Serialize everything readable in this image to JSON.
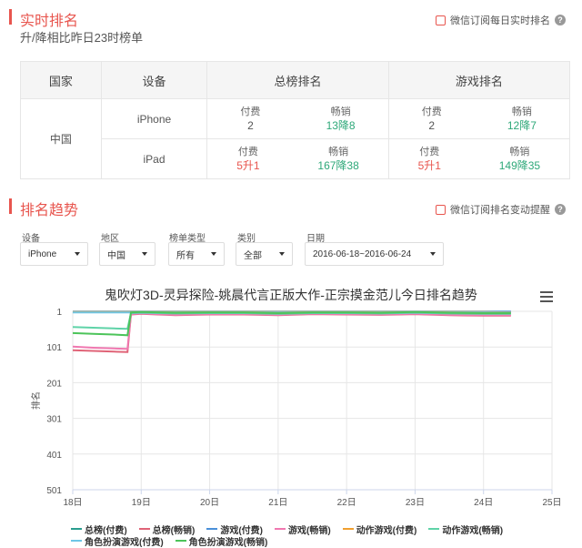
{
  "realtime": {
    "title": "实时排名",
    "subtitle": "升/降相比昨日23时榜单",
    "subscribe": "微信订阅每日实时排名",
    "help": "?"
  },
  "table": {
    "headers": [
      "国家",
      "设备",
      "总榜排名",
      "游戏排名"
    ],
    "country": "中国",
    "rows": [
      {
        "device": "iPhone",
        "total": {
          "paid_label": "付费",
          "paid_value": "2",
          "sales_label": "畅销",
          "sales_value": "13降8"
        },
        "game": {
          "paid_label": "付费",
          "paid_value": "2",
          "sales_label": "畅销",
          "sales_value": "12降7"
        }
      },
      {
        "device": "iPad",
        "total": {
          "paid_label": "付费",
          "paid_value": "5升1",
          "sales_label": "畅销",
          "sales_value": "167降38"
        },
        "game": {
          "paid_label": "付费",
          "paid_value": "5升1",
          "sales_label": "畅销",
          "sales_value": "149降35"
        }
      }
    ]
  },
  "trend": {
    "title": "排名趋势",
    "subscribe": "微信订阅排名变动提醒",
    "help": "?",
    "filters": [
      {
        "label": "设备",
        "value": "iPhone"
      },
      {
        "label": "地区",
        "value": "中国"
      },
      {
        "label": "榜单类型",
        "value": "所有"
      },
      {
        "label": "类别",
        "value": "全部"
      },
      {
        "label": "日期",
        "value": "2016-06-18~2016-06-24"
      }
    ]
  },
  "chart_data": {
    "type": "line",
    "title": "鬼吹灯3D-灵异探险-姚晨代言正版大作-正宗摸金范儿今日排名趋势",
    "ylabel": "排名",
    "y_reversed": true,
    "ylim": [
      1,
      501
    ],
    "yticks": [
      "1",
      "101",
      "201",
      "301",
      "401",
      "501"
    ],
    "x_ticks": [
      "18日",
      "19日",
      "20日",
      "21日",
      "22日",
      "23日",
      "24日",
      "25日"
    ],
    "xlim": [
      18,
      25
    ],
    "grid": true,
    "legend_position": "bottom",
    "series": [
      {
        "name": "总榜(付费)",
        "color": "#2a9d8f",
        "points": [
          [
            18,
            2
          ],
          [
            18.8,
            2
          ],
          [
            19,
            2
          ],
          [
            20,
            2
          ],
          [
            21,
            2
          ],
          [
            22,
            2
          ],
          [
            23,
            2
          ],
          [
            24,
            2
          ],
          [
            24.4,
            2
          ]
        ]
      },
      {
        "name": "总榜(畅销)",
        "color": "#e06377",
        "points": [
          [
            18,
            110
          ],
          [
            18.3,
            112
          ],
          [
            18.6,
            114
          ],
          [
            18.8,
            115
          ],
          [
            18.85,
            10
          ],
          [
            19,
            8
          ],
          [
            19.5,
            12
          ],
          [
            20,
            10
          ],
          [
            20.5,
            10
          ],
          [
            21,
            12
          ],
          [
            21.5,
            9
          ],
          [
            22,
            10
          ],
          [
            22.5,
            11
          ],
          [
            23,
            9
          ],
          [
            23.5,
            12
          ],
          [
            24,
            13
          ],
          [
            24.4,
            13
          ]
        ]
      },
      {
        "name": "游戏(付费)",
        "color": "#4a90d9",
        "points": [
          [
            18,
            2
          ],
          [
            18.8,
            2
          ],
          [
            19,
            2
          ],
          [
            20,
            2
          ],
          [
            21,
            2
          ],
          [
            22,
            2
          ],
          [
            23,
            2
          ],
          [
            24,
            2
          ],
          [
            24.4,
            2
          ]
        ]
      },
      {
        "name": "游戏(畅销)",
        "color": "#f078b0",
        "points": [
          [
            18,
            100
          ],
          [
            18.3,
            103
          ],
          [
            18.6,
            105
          ],
          [
            18.8,
            106
          ],
          [
            18.85,
            9
          ],
          [
            19,
            7
          ],
          [
            19.5,
            11
          ],
          [
            20,
            9
          ],
          [
            20.5,
            9
          ],
          [
            21,
            11
          ],
          [
            21.5,
            8
          ],
          [
            22,
            9
          ],
          [
            22.5,
            10
          ],
          [
            23,
            8
          ],
          [
            23.5,
            11
          ],
          [
            24,
            12
          ],
          [
            24.4,
            12
          ]
        ]
      },
      {
        "name": "动作游戏(付费)",
        "color": "#f0a030",
        "points": [
          [
            18,
            3
          ],
          [
            18.8,
            3
          ],
          [
            19,
            3
          ],
          [
            20,
            3
          ],
          [
            21,
            3
          ],
          [
            22,
            3
          ],
          [
            23,
            3
          ],
          [
            24,
            3
          ],
          [
            24.4,
            4
          ]
        ]
      },
      {
        "name": "动作游戏(畅销)",
        "color": "#5fd3a8",
        "points": [
          [
            18,
            45
          ],
          [
            18.3,
            47
          ],
          [
            18.6,
            49
          ],
          [
            18.8,
            50
          ],
          [
            18.85,
            6
          ],
          [
            19,
            5
          ],
          [
            19.5,
            7
          ],
          [
            20,
            6
          ],
          [
            20.5,
            6
          ],
          [
            21,
            8
          ],
          [
            21.5,
            6
          ],
          [
            22,
            6
          ],
          [
            22.5,
            7
          ],
          [
            23,
            5
          ],
          [
            23.5,
            7
          ],
          [
            24,
            8
          ],
          [
            24.4,
            8
          ]
        ]
      },
      {
        "name": "角色扮演游戏(付费)",
        "color": "#6ec6e6",
        "points": [
          [
            18,
            4
          ],
          [
            18.8,
            4
          ],
          [
            19,
            4
          ],
          [
            20,
            4
          ],
          [
            21,
            4
          ],
          [
            22,
            4
          ],
          [
            23,
            4
          ],
          [
            24,
            4
          ],
          [
            24.4,
            5
          ]
        ]
      },
      {
        "name": "角色扮演游戏(畅销)",
        "color": "#4cc45a",
        "points": [
          [
            18,
            62
          ],
          [
            18.3,
            64
          ],
          [
            18.6,
            66
          ],
          [
            18.8,
            68
          ],
          [
            18.85,
            4
          ],
          [
            19,
            3
          ],
          [
            19.5,
            5
          ],
          [
            20,
            4
          ],
          [
            20.5,
            4
          ],
          [
            21,
            6
          ],
          [
            21.5,
            4
          ],
          [
            22,
            4
          ],
          [
            22.5,
            5
          ],
          [
            23,
            3
          ],
          [
            23.5,
            5
          ],
          [
            24,
            6
          ],
          [
            24.4,
            6
          ]
        ]
      }
    ]
  }
}
